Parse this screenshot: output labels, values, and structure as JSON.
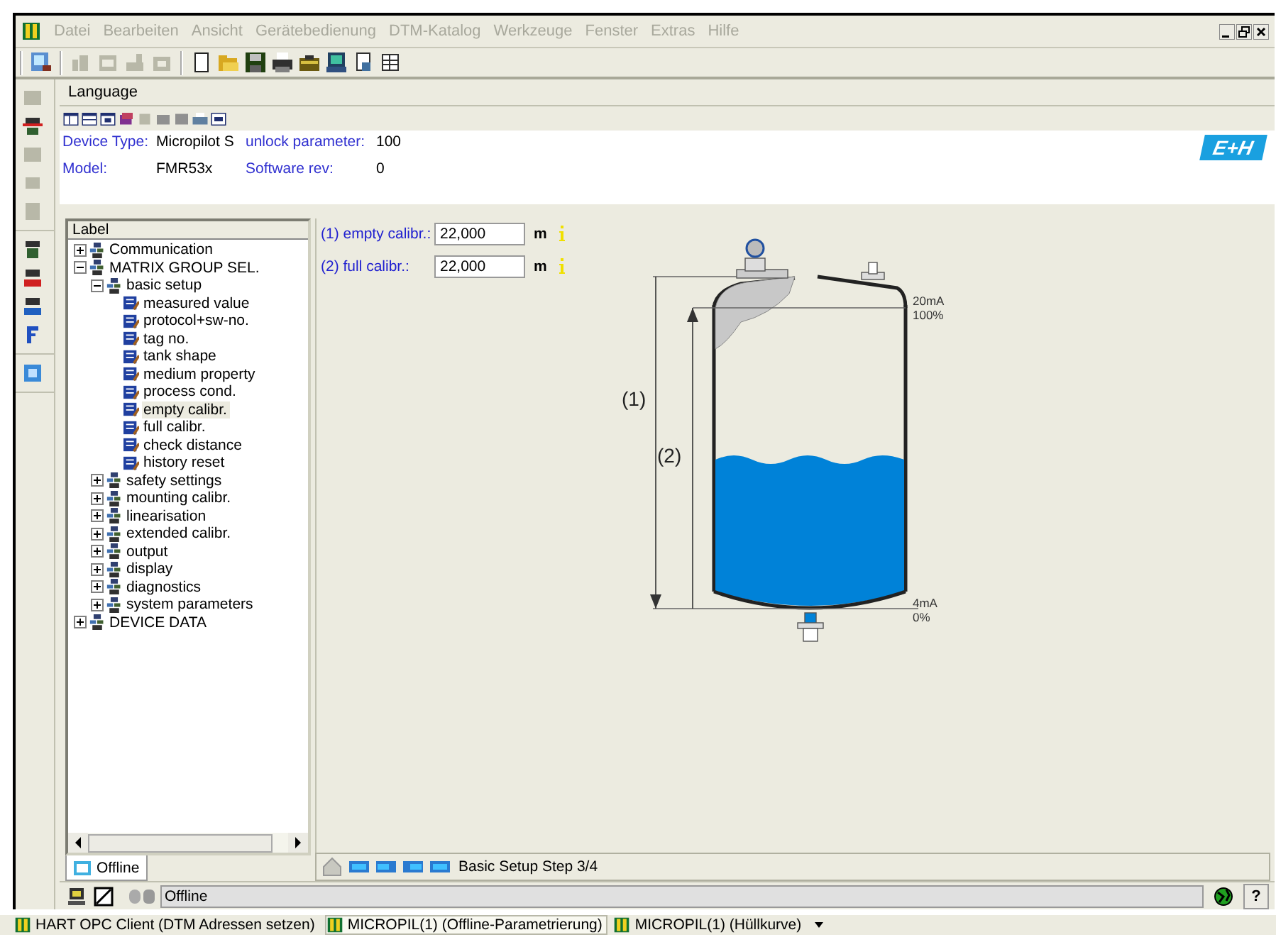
{
  "menu": [
    "Datei",
    "Bearbeiten",
    "Ansicht",
    "Gerätebedienung",
    "DTM-Katalog",
    "Werkzeuge",
    "Fenster",
    "Extras",
    "Hilfe"
  ],
  "panel": {
    "title": "Language"
  },
  "info_fields": [
    {
      "label": "Device Type:",
      "value": "Micropilot S"
    },
    {
      "label": "unlock parameter:",
      "value": "100"
    },
    {
      "label": "Model:",
      "value": "FMR53x"
    },
    {
      "label": "Software rev:",
      "value": "0"
    }
  ],
  "logo": "E+H",
  "tree": {
    "heading": "Label",
    "items": [
      {
        "label": "Communication",
        "kind": "group",
        "expanded": false,
        "selected": false
      },
      {
        "label": "MATRIX GROUP SEL.",
        "kind": "group",
        "expanded": true,
        "selected": false,
        "children": [
          {
            "label": "basic setup",
            "kind": "group",
            "expanded": true,
            "selected": false,
            "children": [
              {
                "label": "measured value",
                "kind": "parameter",
                "selected": false
              },
              {
                "label": "protocol+sw-no.",
                "kind": "parameter",
                "selected": false
              },
              {
                "label": "tag no.",
                "kind": "parameter",
                "selected": false
              },
              {
                "label": "tank shape",
                "kind": "parameter",
                "selected": false
              },
              {
                "label": "medium property",
                "kind": "parameter",
                "selected": false
              },
              {
                "label": "process cond.",
                "kind": "parameter",
                "selected": false
              },
              {
                "label": "empty calibr.",
                "kind": "parameter",
                "selected": true
              },
              {
                "label": "full calibr.",
                "kind": "parameter",
                "selected": false
              },
              {
                "label": "check distance",
                "kind": "parameter",
                "selected": false
              },
              {
                "label": "history reset",
                "kind": "parameter",
                "selected": false
              }
            ]
          },
          {
            "label": "safety settings",
            "kind": "group",
            "expanded": false,
            "selected": false
          },
          {
            "label": "mounting calibr.",
            "kind": "group",
            "expanded": false,
            "selected": false
          },
          {
            "label": "linearisation",
            "kind": "group",
            "expanded": false,
            "selected": false
          },
          {
            "label": "extended calibr.",
            "kind": "group",
            "expanded": false,
            "selected": false
          },
          {
            "label": "output",
            "kind": "group",
            "expanded": false,
            "selected": false
          },
          {
            "label": "display",
            "kind": "group",
            "expanded": false,
            "selected": false
          },
          {
            "label": "diagnostics",
            "kind": "group",
            "expanded": false,
            "selected": false
          },
          {
            "label": "system parameters",
            "kind": "group",
            "expanded": false,
            "selected": false
          }
        ]
      },
      {
        "label": "DEVICE DATA",
        "kind": "group",
        "expanded": false,
        "selected": false
      }
    ]
  },
  "form": [
    {
      "label": "(1) empty calibr.:",
      "value": "22,000",
      "unit": "m"
    },
    {
      "label": "(2) full calibr.:",
      "value": "22,000",
      "unit": "m"
    }
  ],
  "diagram": {
    "dimension_1": "(1)",
    "dimension_2": "(2)",
    "top_current": "20mA",
    "top_percent": "100%",
    "bottom_current": "4mA",
    "bottom_percent": "0%"
  },
  "view_tabs": [
    {
      "label": "Offline",
      "selected": true
    }
  ],
  "navigator": {
    "step": "Basic Setup Step 3/4"
  },
  "status_bar": {
    "state": "Offline",
    "help": "?"
  },
  "taskbar": [
    {
      "label": "HART OPC Client (DTM Adressen setzen)",
      "selected": false
    },
    {
      "label": "MICROPIL(1) (Offline-Parametrierung)",
      "selected": true
    },
    {
      "label": "MICROPIL(1) (Hüllkurve)",
      "selected": false
    }
  ]
}
